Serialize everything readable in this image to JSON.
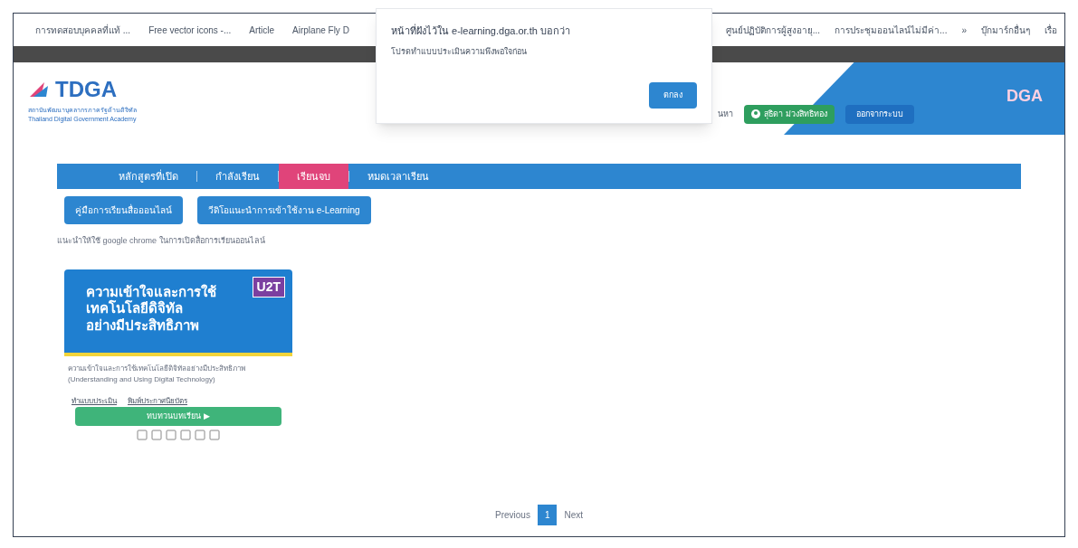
{
  "bookmarks": [
    {
      "label": "การทดสอบบุคคลที่แท้ ..."
    },
    {
      "label": "Free vector icons -..."
    },
    {
      "label": "Article"
    },
    {
      "label": "Airplane Fly D"
    },
    {
      "label": "ศูนย์ปฏิบัติการผู้สูงอายุ..."
    },
    {
      "label": "การประชุมออนไลน์ไม่มีค่า..."
    },
    {
      "label": "»"
    },
    {
      "label": "บุ๊กมาร์กอื่นๆ"
    },
    {
      "label": "เรื่อ"
    }
  ],
  "dialog": {
    "title": "หน้าที่ฝังไว้ใน e-learning.dga.or.th บอกว่า",
    "message": "โปรดทำแบบประเมินความพึงพอใจก่อน",
    "button": "ตกลง"
  },
  "header": {
    "logo": "TDGA",
    "logo_subtitle_th": "สถาบันพัฒนาบุคลากรภาครัฐด้านดิจิทัล",
    "logo_subtitle_en": "Thailand Digital Government Academy",
    "search_label": "นหา",
    "user": "สุธิดา ม่วงสิทธิทอง",
    "logout": "ออกจากระบบ",
    "brand": "DGA"
  },
  "tabs": [
    {
      "label": "หลักสูตรที่เปิด",
      "selected": false
    },
    {
      "label": "กำลังเรียน",
      "selected": false
    },
    {
      "label": "เรียนจบ",
      "selected": true
    },
    {
      "label": "หมดเวลาเรียน",
      "selected": false
    }
  ],
  "actions": [
    "คู่มือการเรียนสื่อออนไลน์",
    "วีดิโอแนะนำการเข้าใช้งาน e-Learning"
  ],
  "note": "แนะนำให้ใช้ google chrome ในการเปิดสื่อการเรียนออนไลน์",
  "courses": [
    {
      "banner_title": [
        "ความเข้าใจและการใช้",
        "เทคโนโลยีดิจิทัล",
        "อย่างมีประสิทธิภาพ"
      ],
      "badge": "U2T",
      "title": "ความเข้าใจและการใช้เทคโนโลยีดิจิทัลอย่างมีประสิทธิภาพ (Understanding and Using Digital Technology)",
      "links": [
        "ทำแบบประเมิน",
        "พิมพ์ประกาศนียบัตร"
      ],
      "button": "ทบทวนบทเรียน ▶"
    }
  ],
  "pagination": {
    "previous": "Previous",
    "pages": [
      {
        "label": "1",
        "selected": true
      }
    ],
    "next": "Next"
  }
}
